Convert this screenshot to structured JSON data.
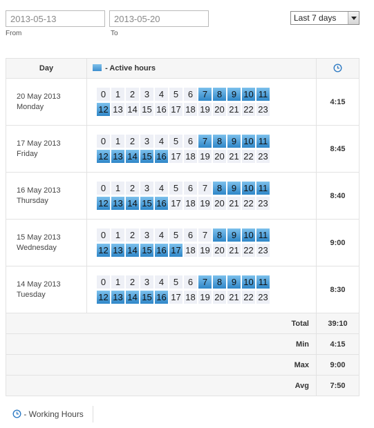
{
  "filters": {
    "from_value": "2013-05-13",
    "from_label": "From",
    "to_value": "2013-05-20",
    "to_label": "To",
    "range_selected": "Last 7 days"
  },
  "table": {
    "headers": {
      "day": "Day",
      "active_hours": "- Active hours",
      "clock_icon": "clock-icon"
    },
    "rows": [
      {
        "date": "20 May 2013",
        "weekday": "Monday",
        "total": "4:15",
        "active": [
          7,
          8,
          9,
          10,
          11,
          12
        ]
      },
      {
        "date": "17 May 2013",
        "weekday": "Friday",
        "total": "8:45",
        "active": [
          7,
          8,
          9,
          10,
          11,
          12,
          13,
          14,
          15,
          16
        ]
      },
      {
        "date": "16 May 2013",
        "weekday": "Thursday",
        "total": "8:40",
        "active": [
          8,
          9,
          10,
          11,
          12,
          13,
          14,
          15,
          16
        ]
      },
      {
        "date": "15 May 2013",
        "weekday": "Wednesday",
        "total": "9:00",
        "active": [
          8,
          9,
          10,
          11,
          12,
          13,
          14,
          15,
          16,
          17
        ]
      },
      {
        "date": "14 May 2013",
        "weekday": "Tuesday",
        "total": "8:30",
        "active": [
          7,
          8,
          9,
          10,
          11,
          12,
          13,
          14,
          15,
          16
        ]
      }
    ],
    "hours_line1": [
      "0",
      "1",
      "2",
      "3",
      "4",
      "5",
      "6",
      "7",
      "8",
      "9",
      "10",
      "11"
    ],
    "hours_line2": [
      "12",
      "13",
      "14",
      "15",
      "16",
      "17",
      "18",
      "19",
      "20",
      "21",
      "22",
      "23"
    ],
    "summary": [
      {
        "label": "Total",
        "value": "39:10"
      },
      {
        "label": "Min",
        "value": "4:15"
      },
      {
        "label": "Max",
        "value": "9:00"
      },
      {
        "label": "Avg",
        "value": "7:50"
      }
    ]
  },
  "legend": {
    "working_hours": "- Working Hours"
  },
  "colors": {
    "active": "#3c8fcf",
    "inactive": "#eef0f6",
    "clock": "#2f7bc4"
  }
}
